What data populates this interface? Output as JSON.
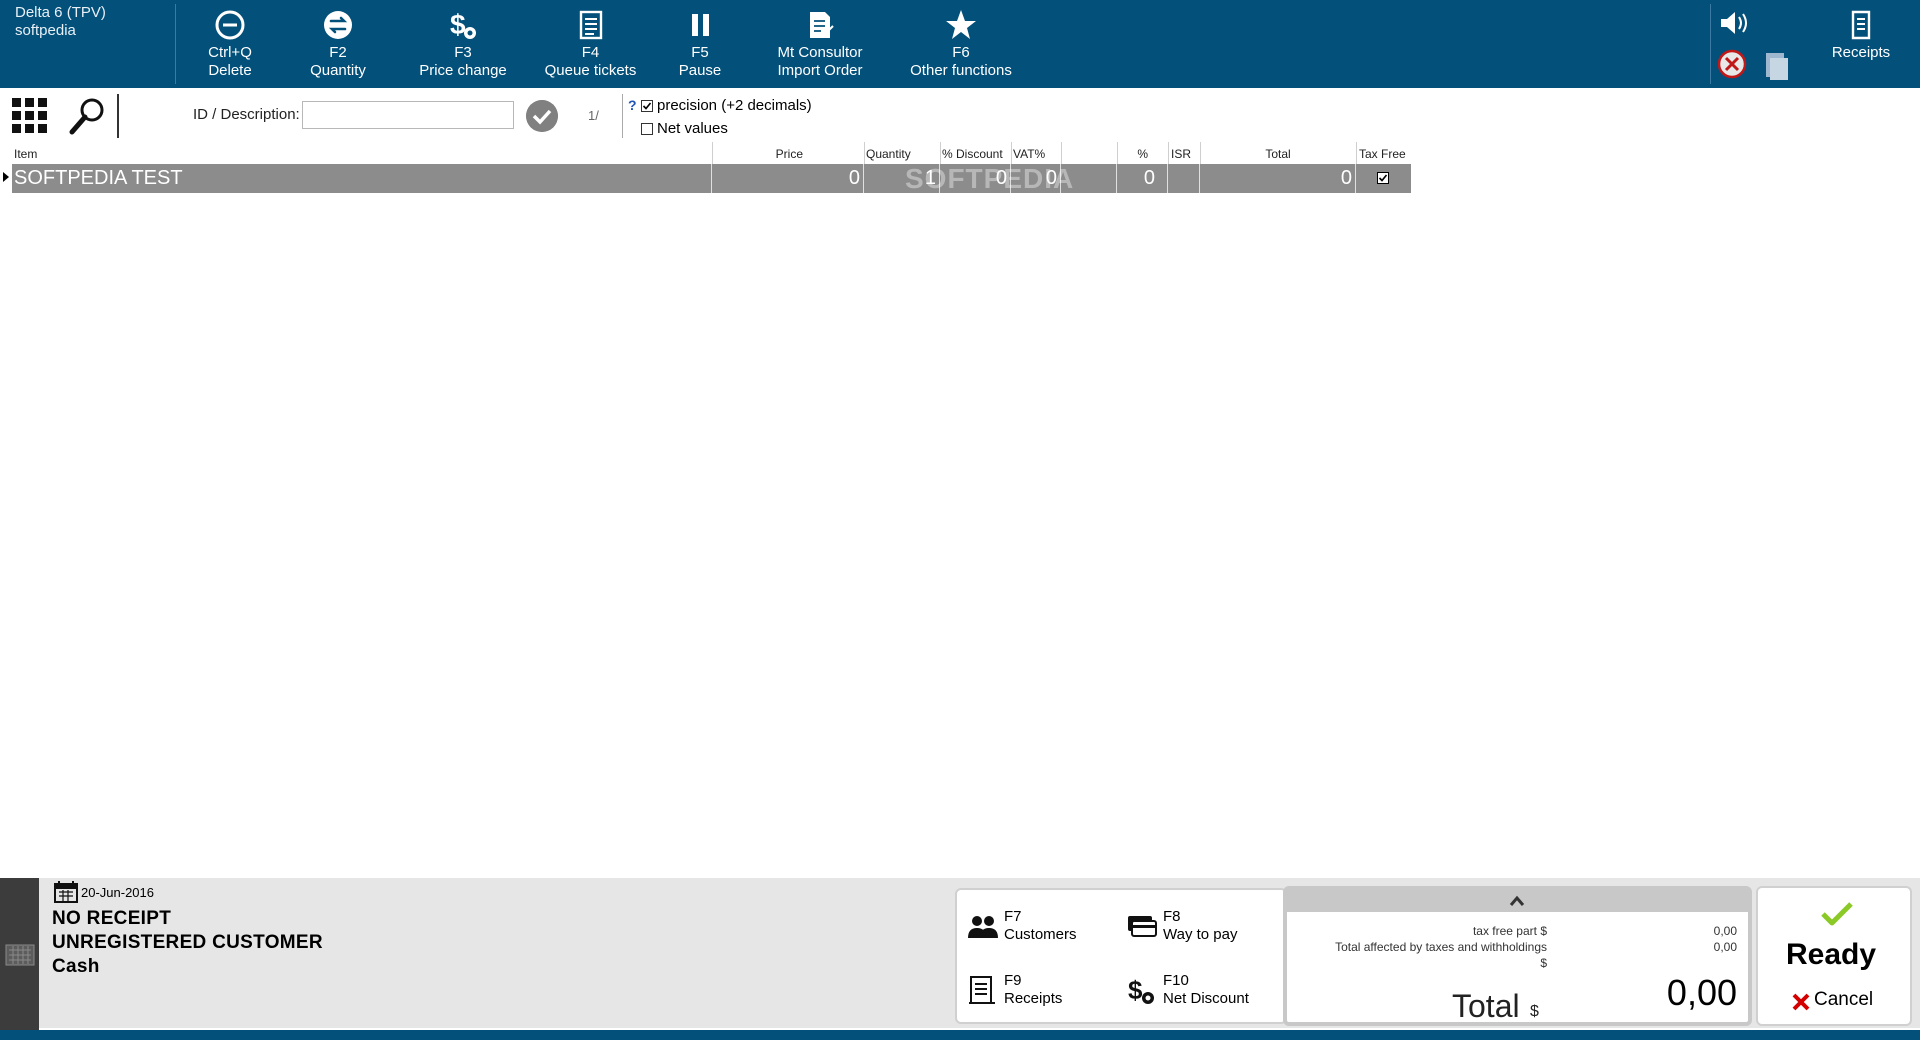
{
  "app": {
    "title": "Delta 6 (TPV)",
    "user": "softpedia"
  },
  "toolbar": [
    {
      "key": "Ctrl+Q",
      "label": "Delete",
      "icon": "minus-circle-icon"
    },
    {
      "key": "F2",
      "label": "Quantity",
      "icon": "swap-circle-icon"
    },
    {
      "key": "F3",
      "label": "Price change",
      "icon": "dollar-settings-icon"
    },
    {
      "key": "F4",
      "label": "Queue tickets",
      "icon": "document-list-icon"
    },
    {
      "key": "F5",
      "label": "Pause",
      "icon": "pause-icon"
    },
    {
      "key": "Mt Consultor",
      "label": "Import Order",
      "icon": "document-edit-icon"
    },
    {
      "key": "F6",
      "label": "Other functions",
      "icon": "star-icon"
    }
  ],
  "receipts_button": {
    "label": "Receipts",
    "icon": "receipt-icon"
  },
  "search": {
    "label": "ID / Description:",
    "value": "",
    "placeholder": "",
    "counter": "1/"
  },
  "options": {
    "help": "?",
    "precision": {
      "label": "precision (+2 decimals)",
      "checked": true
    },
    "net_values": {
      "label": "Net values",
      "checked": false
    }
  },
  "table": {
    "headers": {
      "item": "Item",
      "price": "Price",
      "quantity": "Quantity",
      "discount": "% Discount",
      "vat": "VAT%",
      "pct": "%",
      "isr": "ISR",
      "total": "Total",
      "tax_free": "Tax Free"
    },
    "rows": [
      {
        "item": "SOFTPEDIA TEST",
        "price": "0",
        "quantity": "1",
        "discount": "0",
        "vat": "0",
        "pct": "0",
        "isr": "",
        "total": "0",
        "tax_free": true
      }
    ],
    "watermark": "SOFTPEDIA"
  },
  "receipt_info": {
    "date": "20-Jun-2016",
    "receipt": "NO RECEIPT",
    "customer": "UNREGISTERED CUSTOMER",
    "payment": "Cash"
  },
  "function_buttons": [
    {
      "key": "F7",
      "label": "Customers",
      "icon": "users-icon"
    },
    {
      "key": "F8",
      "label": "Way to pay",
      "icon": "credit-cards-icon"
    },
    {
      "key": "F9",
      "label": "Receipts",
      "icon": "receipt-icon"
    },
    {
      "key": "F10",
      "label": "Net Discount",
      "icon": "dollar-settings-icon"
    }
  ],
  "totals": {
    "tax_free_label": "tax free part $",
    "tax_free_value": "0,00",
    "affected_label": "Total affected by taxes and withholdings",
    "affected_currency": "$",
    "affected_value": "0,00",
    "total_label": "Total",
    "total_currency": "$",
    "total_value": "0,00"
  },
  "actions": {
    "ready": "Ready",
    "cancel": "Cancel"
  },
  "colors": {
    "toolbar_bg": "#03507a",
    "selected_row": "#8c8c8c",
    "ready_check": "#8ac926",
    "cancel_x": "#d40000"
  }
}
